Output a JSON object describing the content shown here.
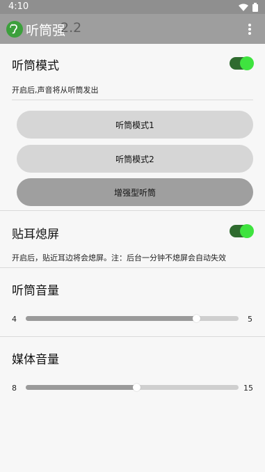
{
  "status_bar": {
    "time": "4:10",
    "icons": [
      "wifi-icon",
      "battery-icon"
    ]
  },
  "app_bar": {
    "title": "听筒强",
    "version": "2.2",
    "menu_icon": "overflow-menu-icon"
  },
  "receiver_mode": {
    "title": "听筒模式",
    "enabled": true,
    "description": "开启后,声音将从听筒发出",
    "buttons": [
      {
        "label": "听筒模式1",
        "selected": false
      },
      {
        "label": "听筒模式2",
        "selected": false
      },
      {
        "label": "增强型听筒",
        "selected": true
      }
    ]
  },
  "proximity": {
    "title": "贴耳熄屏",
    "enabled": true,
    "description": "开启后，贴近耳边将会熄屏。注：后台一分钟不熄屏会自动失效"
  },
  "receiver_volume": {
    "title": "听筒音量",
    "min": "4",
    "max": "5",
    "fraction": 0.8
  },
  "media_volume": {
    "title": "媒体音量",
    "min": "8",
    "max": "15",
    "fraction": 0.52
  },
  "colors": {
    "accent": "#3fe33f",
    "switch_track": "#2f6b2f",
    "app_bar": "#9e9e9e"
  }
}
